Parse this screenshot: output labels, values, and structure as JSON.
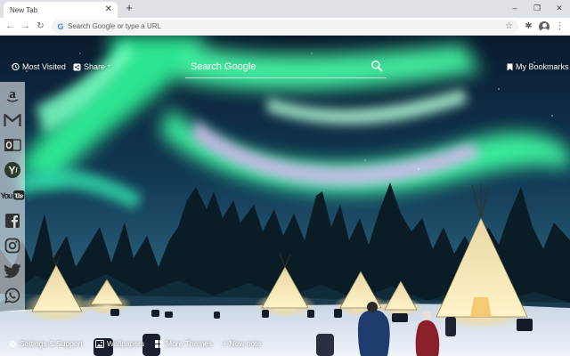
{
  "browser": {
    "tab": {
      "title": "New Tab",
      "close_icon": "close-icon"
    },
    "new_tab_glyph": "+",
    "window_controls": {
      "minimize": "–",
      "restore": "❐",
      "close": "✕"
    },
    "toolbar": {
      "back_glyph": "←",
      "forward_glyph": "→",
      "reload_glyph": "↻",
      "omnibox_placeholder": "Search Google or type a URL",
      "omnibox_icon": "G",
      "star_glyph": "☆",
      "extensions_glyph": "✱",
      "menu_glyph": "⋮"
    }
  },
  "newtab": {
    "most_visited_label": "Most Visited",
    "share_label": "Share",
    "share_superscript": "+",
    "search_placeholder": "Search Google",
    "bookmarks_label": "My Bookmarks",
    "sidebar_items": [
      {
        "icon": "amazon-icon"
      },
      {
        "icon": "gmail-icon"
      },
      {
        "icon": "outlook-icon"
      },
      {
        "icon": "yahoo-icon"
      },
      {
        "icon": "youtube-icon",
        "text": "YouTube"
      },
      {
        "icon": "facebook-icon"
      },
      {
        "icon": "instagram-icon"
      },
      {
        "icon": "twitter-icon"
      },
      {
        "icon": "whatsapp-icon"
      }
    ],
    "bottom_bar": {
      "settings_label": "Settings & Support",
      "wallpapers_label": "Wallpapers",
      "themes_label": "More Themes",
      "new_note_label": "+ New note"
    }
  },
  "colors": {
    "aurora_green": "#3cf7a0",
    "aurora_purple": "#c9a6e6",
    "sky": "#0f2a44",
    "snow": "#e6eef8",
    "tent_glow": "#f7e2a6"
  }
}
